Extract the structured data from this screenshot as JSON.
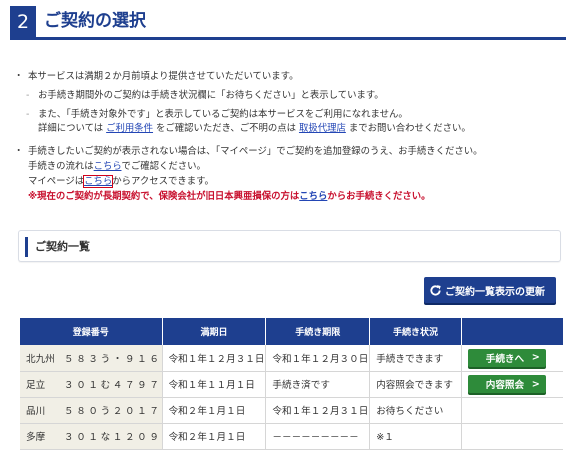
{
  "header": {
    "step_number": "2",
    "title": "ご契約の選択"
  },
  "notes": {
    "item1_line1": "本サービスは満期２か月前頃より提供させていただいています。",
    "item1_sub1": "お手続き期間外のご契約は手続き状況欄に「お待ちください」と表示しています。",
    "item1_sub2_line1": "また、「手続き対象外です」と表示しているご契約は本サービスをご利用になれません。",
    "item1_sub2_line2_pre": "詳細については ",
    "item1_sub2_link1": "ご利用条件",
    "item1_sub2_line2_mid": " をご確認いただき、ご不明の点は ",
    "item1_sub2_link2": "取扱代理店",
    "item1_sub2_line2_post": " までお問い合わせください。",
    "item2_line1": "手続きしたいご契約が表示されない場合は、「マイページ」でご契約を追加登録のうえ、お手続きください。",
    "item2_line2_pre": "手続きの流れは",
    "item2_line2_link": "こちら",
    "item2_line2_post": "でご確認ください。",
    "item2_line3_pre": "マイページは",
    "item2_line3_link": "こちら",
    "item2_line3_post": "からアクセスできます。",
    "warning_pre": "※現在のご契約が長期契約で、保険会社が旧日本興亜損保の方は",
    "warning_link": "こちら",
    "warning_post": "からお手続きください。"
  },
  "section": {
    "title": "ご契約一覧"
  },
  "refresh_button": {
    "label": "ご契約一覧表示の更新",
    "icon": "refresh-icon"
  },
  "table": {
    "headers": [
      "登録番号",
      "満期日",
      "手続き期限",
      "手続き状況",
      ""
    ],
    "rows": [
      {
        "area": "北九州",
        "number": "５８３う・９１６",
        "expiry": "令和１年１２月３１日",
        "deadline": "令和１年１２月３０日",
        "status": "手続きできます",
        "action": "手続きへ"
      },
      {
        "area": "足立",
        "number": "３０１む４７９７",
        "expiry": "令和１年１１月１日",
        "deadline": "手続き済です",
        "status": "内容照会できます",
        "action": "内容照会"
      },
      {
        "area": "品川",
        "number": "５８０う２０１７",
        "expiry": "令和２年１月１日",
        "deadline": "令和１年１２月３１日",
        "status": "お待ちください",
        "action": ""
      },
      {
        "area": "多摩",
        "number": "３０１な１２０９",
        "expiry": "令和２年１月１日",
        "deadline": "－－－－－－－－－",
        "status": "※１",
        "action": ""
      }
    ]
  },
  "colors": {
    "brand_navy": "#1e3f8f",
    "action_green": "#2e8b3a",
    "warning_red": "#c8102e",
    "link_blue": "#2346b5"
  }
}
